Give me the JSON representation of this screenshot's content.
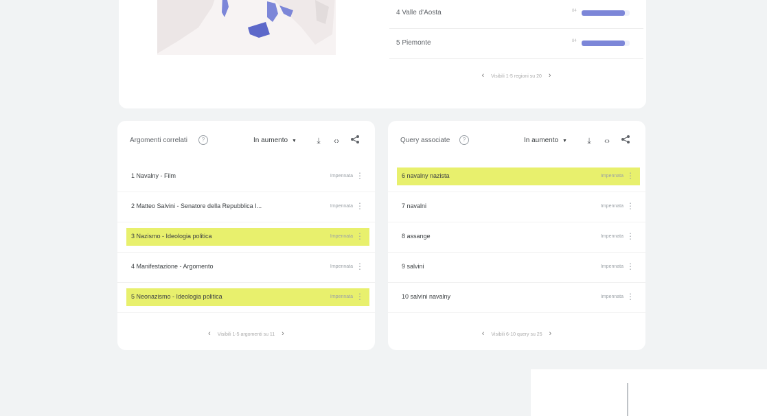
{
  "top_card": {
    "regions": [
      {
        "label": "4  Valle d'Aosta",
        "value": "84",
        "fraction": 0.9
      },
      {
        "label": "5  Piemonte",
        "value": "84",
        "fraction": 0.9
      }
    ],
    "pager_text": "Visibili 1-5 regioni su 20",
    "prev": "‹",
    "next": "›"
  },
  "colors": {
    "map_fill": "#7c86d8",
    "highlight": "#e8f06d"
  },
  "related_topics": {
    "title": "Argomenti correlati",
    "help": "?",
    "select_value": "In aumento",
    "caret": "▼",
    "download_icon": "⤓",
    "embed_icon": "‹›",
    "share_icon": "share",
    "items": [
      {
        "text": "1  Navalny - Film",
        "value": "Impennata",
        "highlighted": false
      },
      {
        "text": "2  Matteo Salvini - Senatore della Repubblica I...",
        "value": "Impennata",
        "highlighted": false
      },
      {
        "text": "3  Nazismo - Ideologia politica",
        "value": "Impennata",
        "highlighted": true
      },
      {
        "text": "4  Manifestazione - Argomento",
        "value": "Impennata",
        "highlighted": false
      },
      {
        "text": "5  Neonazismo - Ideologia politica",
        "value": "Impennata",
        "highlighted": true
      }
    ],
    "pager_text": "Visibili 1-5 argomenti su 11",
    "prev": "‹",
    "next": "›"
  },
  "related_queries": {
    "title": "Query associate",
    "help": "?",
    "select_value": "In aumento",
    "caret": "▼",
    "download_icon": "⤓",
    "embed_icon": "‹›",
    "share_icon": "share",
    "items": [
      {
        "text": "6  navalny nazista",
        "value": "Impennata",
        "highlighted": true
      },
      {
        "text": "7  navalni",
        "value": "Impennata",
        "highlighted": false
      },
      {
        "text": "8  assange",
        "value": "Impennata",
        "highlighted": false
      },
      {
        "text": "9  salvini",
        "value": "Impennata",
        "highlighted": false
      },
      {
        "text": "10  salvini navalny",
        "value": "Impennata",
        "highlighted": false
      }
    ],
    "pager_text": "Visibili 6-10 query su 25",
    "prev": "‹",
    "next": "›"
  }
}
